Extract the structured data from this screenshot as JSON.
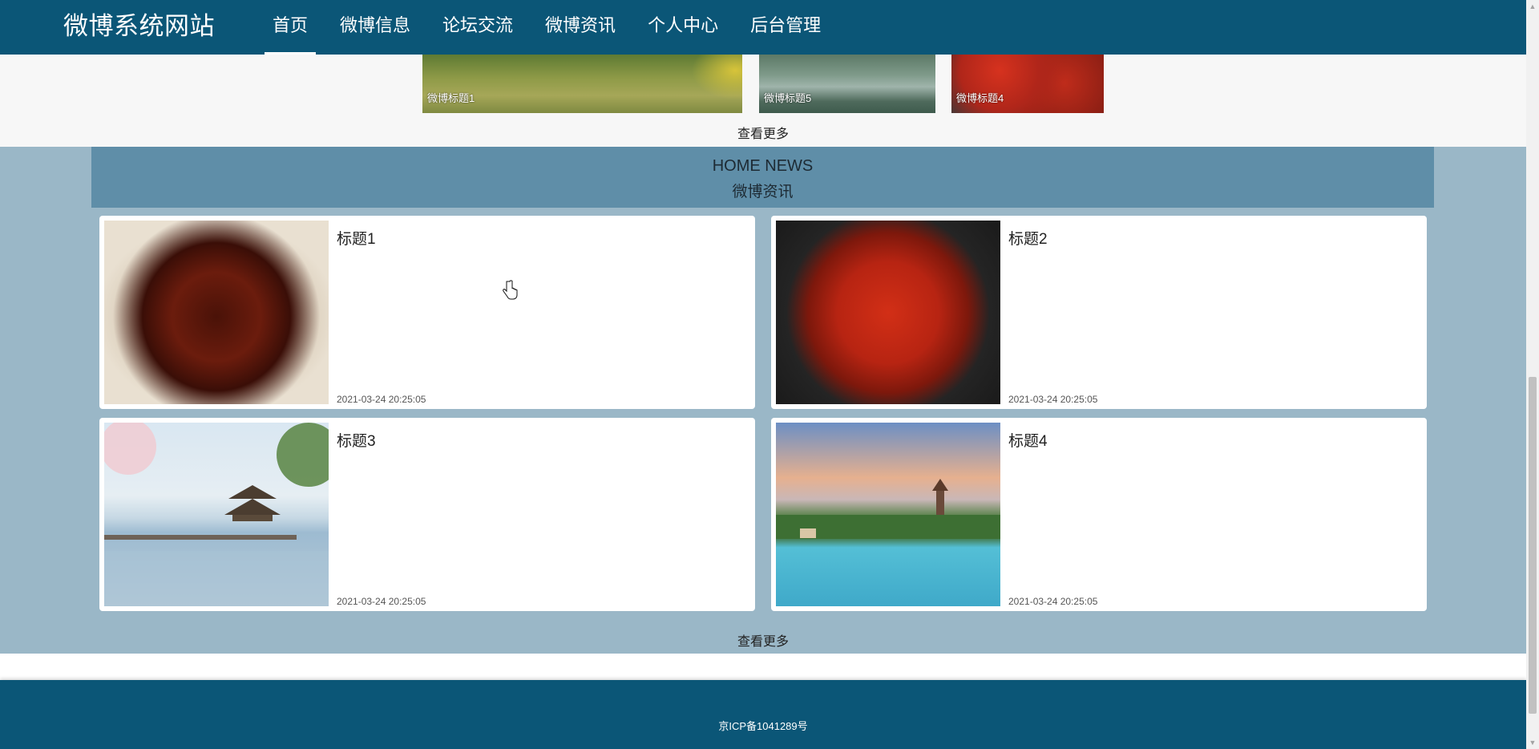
{
  "header": {
    "logo": "微博系统网站",
    "nav": [
      {
        "label": "首页",
        "active": true
      },
      {
        "label": "微博信息",
        "active": false
      },
      {
        "label": "论坛交流",
        "active": false
      },
      {
        "label": "微博资讯",
        "active": false
      },
      {
        "label": "个人中心",
        "active": false
      },
      {
        "label": "后台管理",
        "active": false
      }
    ]
  },
  "gallery": {
    "items": [
      {
        "caption": "微博标题1"
      },
      {
        "caption": "微博标题5"
      },
      {
        "caption": "微博标题4"
      }
    ],
    "more": "查看更多"
  },
  "news": {
    "heading_en": "HOME NEWS",
    "heading_cn": "微博资讯",
    "items": [
      {
        "title": "标题1",
        "time": "2021-03-24 20:25:05",
        "image": "braised-pork"
      },
      {
        "title": "标题2",
        "time": "2021-03-24 20:25:05",
        "image": "crawfish"
      },
      {
        "title": "标题3",
        "time": "2021-03-24 20:25:05",
        "image": "lake-pavilion"
      },
      {
        "title": "标题4",
        "time": "2021-03-24 20:25:05",
        "image": "leifeng-pagoda"
      }
    ],
    "more": "查看更多"
  },
  "footer": {
    "icp": "京ICP备1041289号"
  },
  "colors": {
    "nav_bg": "#0b5677",
    "news_bg": "#9ab7c7",
    "news_header_bg": "#5f8ea8"
  }
}
